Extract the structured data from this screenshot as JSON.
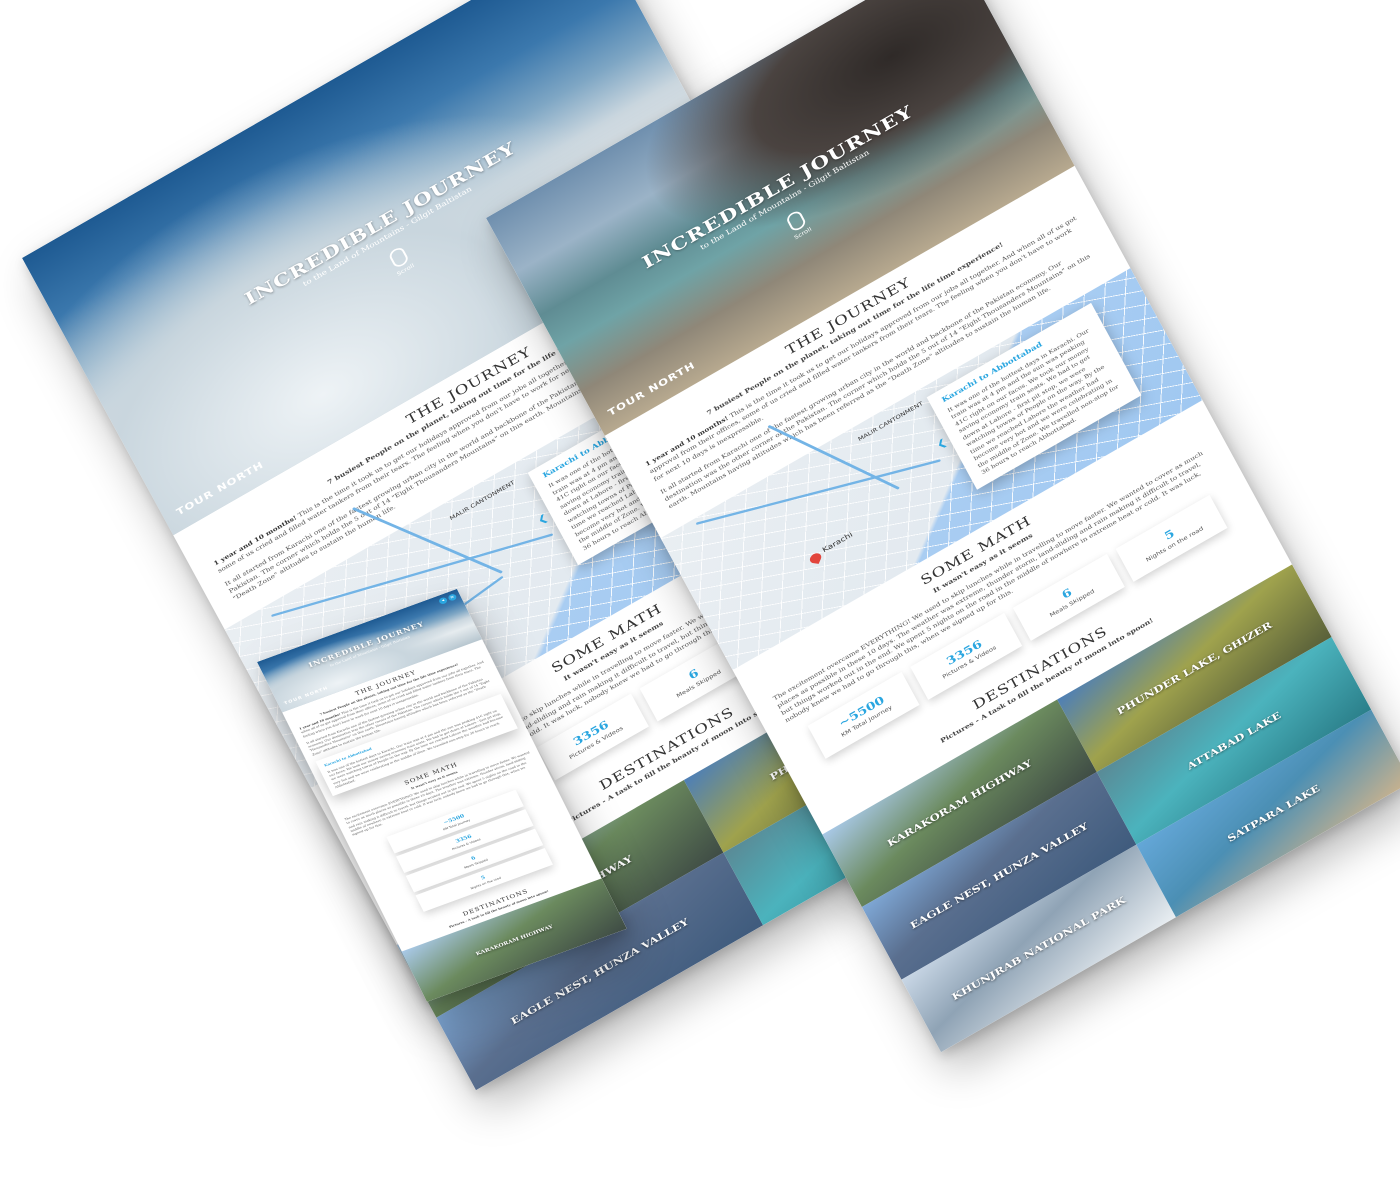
{
  "brand": "TOUR NORTH",
  "hero": {
    "title": "INCREDIBLE JOURNEY",
    "subtitle": "to the Land of Mountains - Gilgit Baltistan",
    "scroll_label": "Scroll"
  },
  "header_buttons": {
    "left": "◂",
    "right": "≡"
  },
  "journey": {
    "title": "THE JOURNEY",
    "tagline": "7 busiest People on the planet, taking out time for the life time experience!",
    "lead": "1 year and 10 months!",
    "para1": "This is the time it took us to get our holidays approved from our jobs all together. And when all of us got approval from their offices, some of us cried and filled water tankers from their tears. The feeling when you don't have to work for next 10 days is inexpressible.",
    "para2": "It all started from Karachi one of the fastest growing urban city in the world and backbone of the Pakistan economy. Our destination was the other corner of the Pakistan. The corner which holds the 5 out of 14 \"Eight Thousanders Mountains\" on this earth. Mountains having altitudes which has been referred as the \"Death Zone\" altitudes to sustain the human life."
  },
  "map": {
    "city_label": "Karachi",
    "cantonment_label": "MALIR CANTONMENT",
    "card_title": "Karachi to Abbottabad",
    "card_text": "It was one of the hottest days in Karachi. Our train was at 4 pm and the sun was peaking 41C right on our faces. We took our money saving economy train seats. We had to get down at Lahore - first pit stop, we were watching towns of People on the way. By the time we reached Lahore the weather had become very hot and we were celebrating in the middle of Zone. We travelled non-stop for 36 hours to reach Abbottabad."
  },
  "math": {
    "title": "SOME MATH",
    "subtitle": "It wasn't easy as it seems",
    "para": "The excitement overcame EVERYTHING! We used to skip lunches while in travelling to move faster. We wanted to cover as much places as possible in these 10 days. The weather was extreme, thunder storm, land-sliding and rain making it difficult to travel, but things worked out in the end. We spent 5 nights on the road in the middle of nowhere in extreme heat or cold. It was luck, nobody knew we had to go through this, when we signed up for this.",
    "stats": [
      {
        "value": "~5500",
        "label": "KM Total Journey"
      },
      {
        "value": "3356",
        "label": "Pictures & Videos"
      },
      {
        "value": "6",
        "label": "Meals Skipped"
      },
      {
        "value": "5",
        "label": "Nights on the road"
      }
    ]
  },
  "destinations": {
    "title": "DESTINATIONS",
    "subtitle": "Pictures - A task to fill the beauty of moon into spoon!",
    "items": [
      "KARAKORAM HIGHWAY",
      "PHUNDER LAKE, GHIZER",
      "EAGLE NEST, HUNZA VALLEY",
      "ATTABAD LAKE",
      "KHUNJRAB NATIONAL PARK",
      "SATPARA LAKE"
    ]
  }
}
